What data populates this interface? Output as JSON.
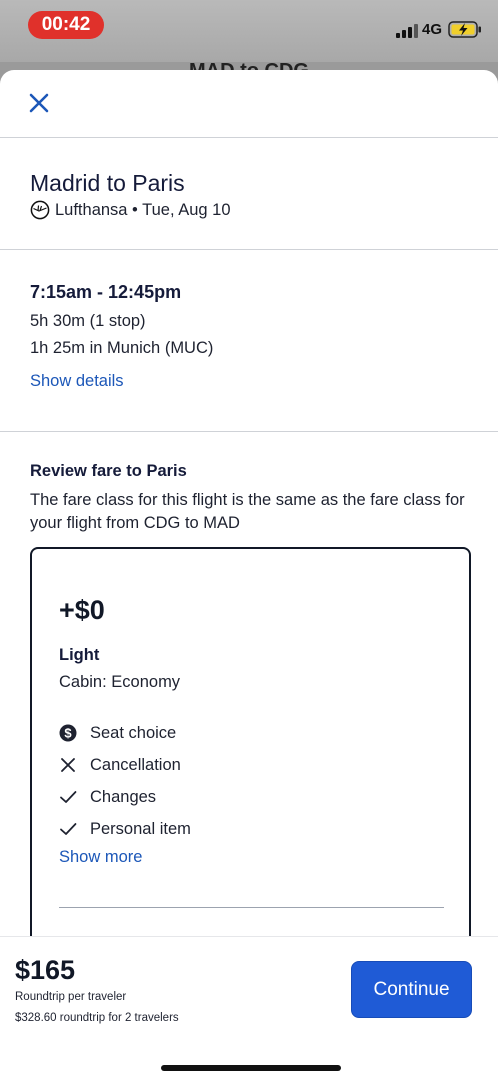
{
  "status_bar": {
    "time": "00:42",
    "network": "4G",
    "icons": [
      "signal-icon",
      "battery-charging-icon"
    ],
    "time_pill_color": "#e0312b"
  },
  "background_title": "MAD to CDG",
  "header": {
    "close_icon": "close-icon"
  },
  "flight": {
    "title": "Madrid to Paris",
    "airline": "Lufthansa • Tue, Aug 10",
    "airline_icon": "lufthansa-logo-icon",
    "times": "7:15am - 12:45pm",
    "duration": "5h 30m (1 stop)",
    "layover": "1h 25m in Munich (MUC)",
    "show_details_label": "Show details"
  },
  "review": {
    "title": "Review fare to Paris",
    "description": "The fare class for this flight is the same as the fare class for your flight from CDG to MAD"
  },
  "fare": {
    "price": "+$0",
    "name": "Light",
    "cabin": "Cabin: Economy",
    "features": [
      {
        "label": "Seat choice",
        "icon": "dollar-circle-icon"
      },
      {
        "label": "Cancellation",
        "icon": "x-icon"
      },
      {
        "label": "Changes",
        "icon": "check-icon"
      },
      {
        "label": "Personal item",
        "icon": "check-icon"
      }
    ],
    "show_more_label": "Show more"
  },
  "footer": {
    "price": "$165",
    "per_traveler": "Roundtrip per traveler",
    "total_note": "$328.60 roundtrip for 2 travelers",
    "continue_label": "Continue"
  },
  "colors": {
    "accent": "#1f5bd6",
    "link": "#1c57b8",
    "text_dark": "#151b3a"
  }
}
